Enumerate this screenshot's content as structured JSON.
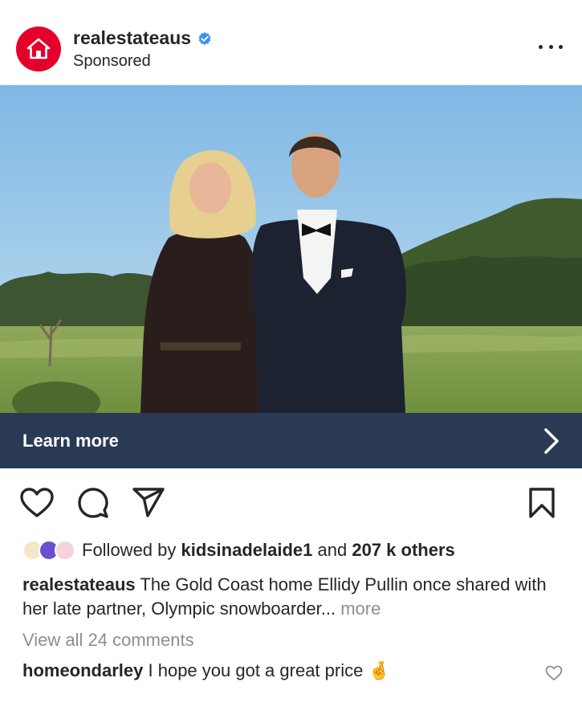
{
  "header": {
    "username": "realestateaus",
    "subtitle": "Sponsored",
    "icons": {
      "avatar": "house-logo-icon",
      "verified": "verified-badge-icon",
      "menu": "more-options-icon"
    }
  },
  "cta": {
    "label": "Learn more",
    "icon": "chevron-right-icon"
  },
  "actions": {
    "icons": [
      "heart-icon",
      "comment-icon",
      "share-icon",
      "bookmark-icon"
    ]
  },
  "social": {
    "prefix": "Followed by",
    "user": "kidsinadelaide1",
    "conj": "and",
    "others": "207 k others"
  },
  "caption": {
    "username": "realestateaus",
    "text": "The Gold Coast home Ellidy Pullin once shared with her late partner, Olympic snowboarder...",
    "more": "more"
  },
  "view_comments": "View all 24 comments",
  "comment": {
    "username": "homeondarley",
    "text": "I hope you got a great price",
    "emoji": "🤞"
  },
  "colors": {
    "brand": "#e4002b",
    "verified": "#3897f0",
    "cta_bg": "#2a3a55",
    "muted": "#8e8e8e"
  }
}
